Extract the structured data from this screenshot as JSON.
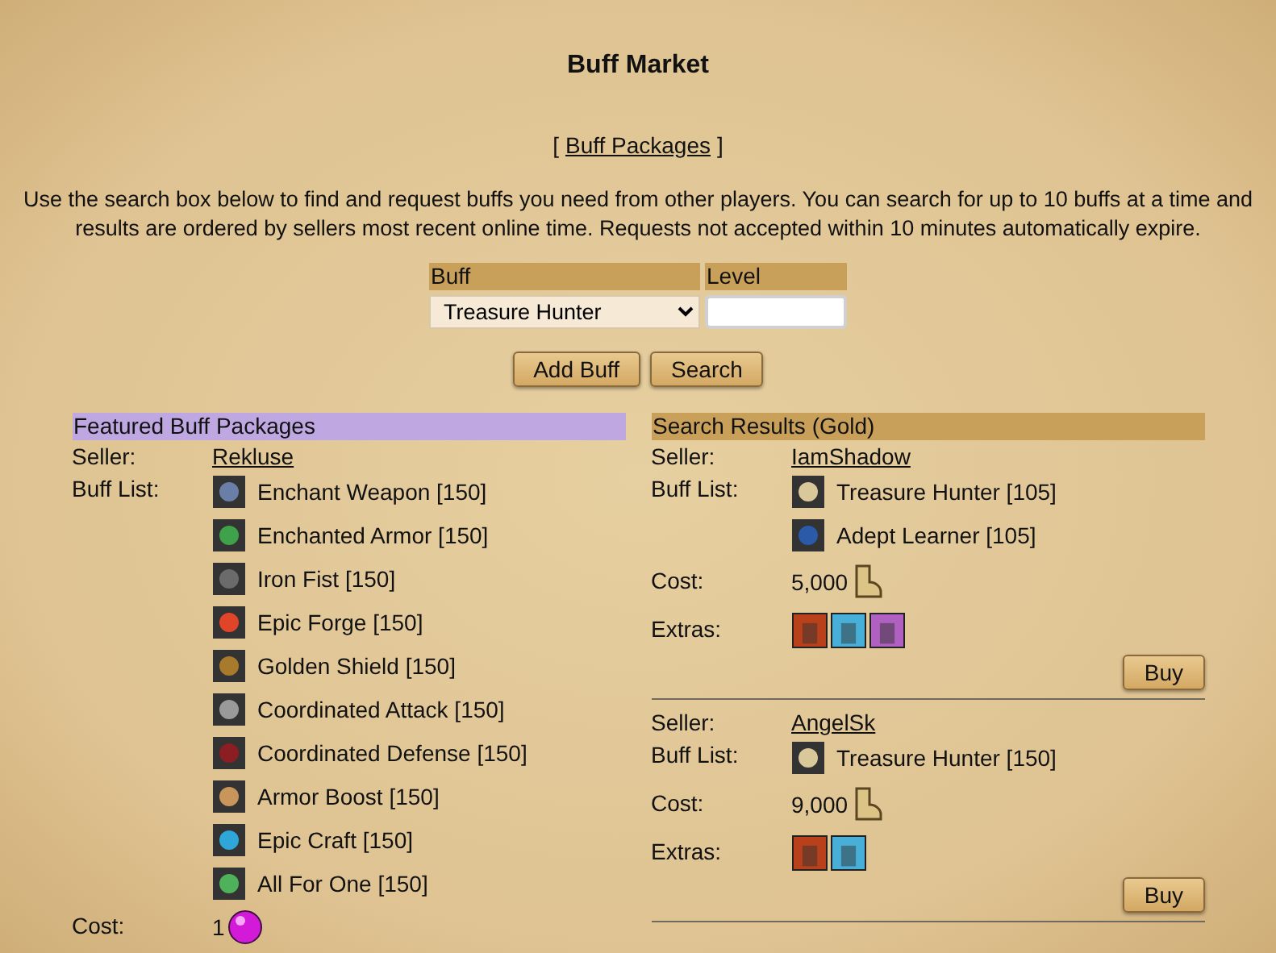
{
  "title": "Buff Market",
  "packages_link": "Buff Packages",
  "bracket_open": "[",
  "bracket_close": "]",
  "intro": "Use the search box below to find and request buffs you need from other players. You can search for up to 10 buffs at a time and results are ordered by sellers most recent online time. Requests not accepted within 10 minutes automatically expire.",
  "form": {
    "buff_label": "Buff",
    "level_label": "Level",
    "buff_value": "Treasure Hunter",
    "buttons": [
      "Add Buff",
      "Search"
    ]
  },
  "featured": {
    "heading": "Featured Buff Packages",
    "seller_label": "Seller:",
    "seller": "Rekluse",
    "buff_list_label": "Buff List:",
    "buffs": [
      {
        "name": "Enchant Weapon [150]",
        "color": "#6a7fa8"
      },
      {
        "name": "Enchanted Armor [150]",
        "color": "#3fa24a"
      },
      {
        "name": "Iron Fist [150]",
        "color": "#6b6b6b"
      },
      {
        "name": "Epic Forge [150]",
        "color": "#e0452a"
      },
      {
        "name": "Golden Shield [150]",
        "color": "#a87a2c"
      },
      {
        "name": "Coordinated Attack [150]",
        "color": "#9a9a9a"
      },
      {
        "name": "Coordinated Defense [150]",
        "color": "#8a1e22"
      },
      {
        "name": "Armor Boost [150]",
        "color": "#c8965a"
      },
      {
        "name": "Epic Craft [150]",
        "color": "#2fa6d8"
      },
      {
        "name": "All For One [150]",
        "color": "#4fb25a"
      }
    ],
    "cost_label": "Cost:",
    "cost": "1",
    "currency": {
      "kind": "gem"
    }
  },
  "results": {
    "heading": "Search Results (Gold)",
    "sellers": [
      {
        "seller_label": "Seller:",
        "seller": "IamShadow",
        "buff_list_label": "Buff List:",
        "buffs": [
          {
            "name": "Treasure Hunter [105]",
            "color": "#d8c89a"
          },
          {
            "name": "Adept Learner [105]",
            "color": "#2a5aa8"
          }
        ],
        "cost_label": "Cost:",
        "cost": "5,000",
        "currency": {
          "kind": "gold"
        },
        "extras_label": "Extras:",
        "extras": [
          {
            "color": "#b8401a"
          },
          {
            "color": "#48b0d8"
          },
          {
            "color": "#b060c0"
          }
        ],
        "button": "Buy"
      },
      {
        "seller_label": "Seller:",
        "seller": "AngelSk",
        "buff_list_label": "Buff List:",
        "buffs": [
          {
            "name": "Treasure Hunter [150]",
            "color": "#d8c89a"
          }
        ],
        "cost_label": "Cost:",
        "cost": "9,000",
        "currency": {
          "kind": "gold"
        },
        "extras_label": "Extras:",
        "extras": [
          {
            "color": "#b8401a"
          },
          {
            "color": "#48b0d8"
          }
        ],
        "button": "Buy"
      }
    ]
  }
}
